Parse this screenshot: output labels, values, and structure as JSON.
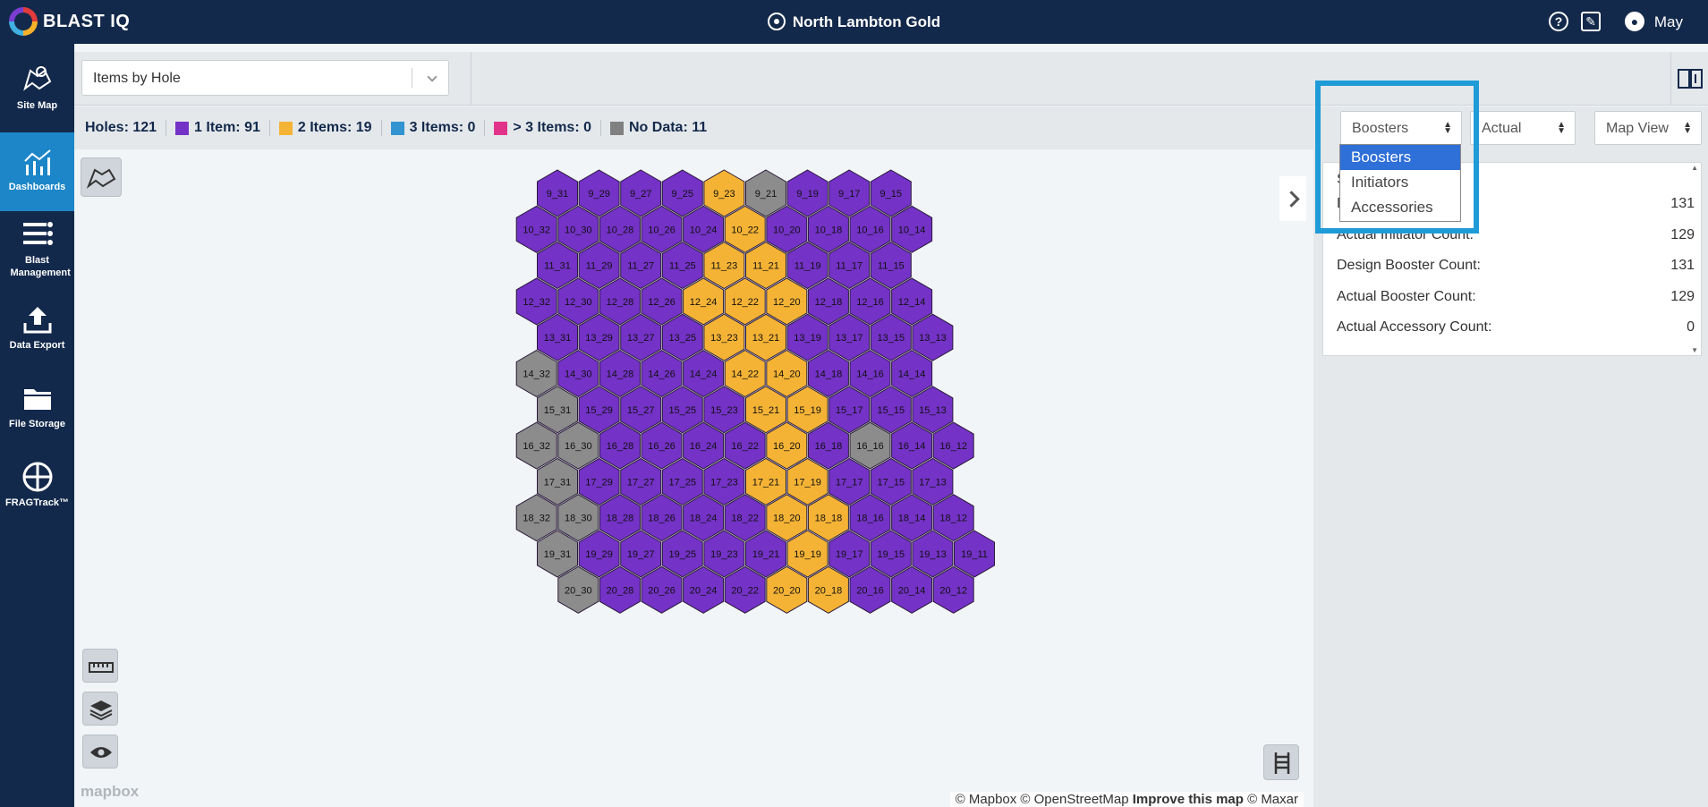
{
  "app": {
    "logo_text": "BLAST IQ",
    "site_title": "North Lambton Gold",
    "user": "May"
  },
  "sidebar": {
    "items": [
      {
        "label": "Site Map",
        "icon": "map-icon",
        "active": false
      },
      {
        "label": "Dashboards",
        "icon": "dashboard-icon",
        "active": true
      },
      {
        "label": "Blast Management",
        "icon": "blast-management-icon",
        "active": false
      },
      {
        "label": "Data Export",
        "icon": "upload-icon",
        "active": false
      },
      {
        "label": "File Storage",
        "icon": "folder-icon",
        "active": false
      },
      {
        "label": "FRAGTrack™",
        "icon": "fragtrack-icon",
        "active": false
      }
    ]
  },
  "controls": {
    "view_select": "Items by Hole"
  },
  "legend": {
    "holes": "Holes: 121",
    "items": [
      {
        "label": "1 Item: 91",
        "color": "#7432c7"
      },
      {
        "label": "2 Items: 19",
        "color": "#f5b335"
      },
      {
        "label": "3 Items: 0",
        "color": "#3294d1"
      },
      {
        "label": "> 3 Items: 0",
        "color": "#e2338b"
      },
      {
        "label": "No Data: 11",
        "color": "#808080"
      }
    ]
  },
  "right_panel": {
    "type_select": "Boosters",
    "mode_select": "Actual",
    "view_select": "Map View",
    "summary_header": "Su",
    "summary_rows": [
      {
        "label": "D",
        "tail": "nt",
        "value": "131"
      },
      {
        "label": "Actual Initiator Count:",
        "value": "129"
      },
      {
        "label": "Design Booster Count:",
        "value": "131"
      },
      {
        "label": "Actual Booster Count:",
        "value": "129"
      },
      {
        "label": "Actual Accessory Count:",
        "value": "0"
      }
    ]
  },
  "dropdown": {
    "options": [
      "Boosters",
      "Initiators",
      "Accessories"
    ],
    "selected": "Boosters"
  },
  "map": {
    "attribution_1": "© Mapbox © OpenStreetMap",
    "attribution_2": "Improve this map",
    "attribution_3": "© Maxar",
    "mapbox_logo": "mapbox",
    "colors": {
      "one": "#7432c7",
      "two": "#f5b335",
      "none": "#8c8c8c"
    },
    "rows": [
      {
        "r": 9,
        "cols": [
          31,
          29,
          27,
          25,
          23,
          21,
          19,
          17,
          15
        ],
        "two": [
          23
        ],
        "none": [
          21
        ]
      },
      {
        "r": 10,
        "cols": [
          32,
          30,
          28,
          26,
          24,
          22,
          20,
          18,
          16,
          14
        ],
        "two": [
          22
        ],
        "none": []
      },
      {
        "r": 11,
        "cols": [
          31,
          29,
          27,
          25,
          23,
          21,
          19,
          17,
          15
        ],
        "two": [
          23,
          21
        ],
        "none": []
      },
      {
        "r": 12,
        "cols": [
          32,
          30,
          28,
          26,
          24,
          22,
          20,
          18,
          16,
          14
        ],
        "two": [
          24,
          22,
          20
        ],
        "none": []
      },
      {
        "r": 13,
        "cols": [
          31,
          29,
          27,
          25,
          23,
          21,
          19,
          17,
          15,
          13
        ],
        "two": [
          23,
          21
        ],
        "none": []
      },
      {
        "r": 14,
        "cols": [
          32,
          30,
          28,
          26,
          24,
          22,
          20,
          18,
          16,
          14
        ],
        "two": [
          22,
          20
        ],
        "none": [
          32
        ]
      },
      {
        "r": 15,
        "cols": [
          31,
          29,
          27,
          25,
          23,
          21,
          19,
          17,
          15,
          13
        ],
        "two": [
          21,
          19
        ],
        "none": [
          31
        ]
      },
      {
        "r": 16,
        "cols": [
          32,
          30,
          28,
          26,
          24,
          22,
          20,
          18,
          16,
          14,
          12
        ],
        "two": [
          20
        ],
        "none": [
          32,
          30,
          16
        ]
      },
      {
        "r": 17,
        "cols": [
          31,
          29,
          27,
          25,
          23,
          21,
          19,
          17,
          15,
          13
        ],
        "two": [
          21,
          19
        ],
        "none": [
          31
        ]
      },
      {
        "r": 18,
        "cols": [
          32,
          30,
          28,
          26,
          24,
          22,
          20,
          18,
          16,
          14,
          12
        ],
        "two": [
          20,
          18
        ],
        "none": [
          32,
          30
        ]
      },
      {
        "r": 19,
        "cols": [
          31,
          29,
          27,
          25,
          23,
          21,
          19,
          17,
          15,
          13,
          11
        ],
        "two": [
          19
        ],
        "none": [
          31
        ]
      },
      {
        "r": 20,
        "cols": [
          30,
          28,
          26,
          24,
          22,
          20,
          18,
          16,
          14,
          12
        ],
        "two": [
          20,
          18
        ],
        "none": [
          30
        ]
      }
    ]
  }
}
